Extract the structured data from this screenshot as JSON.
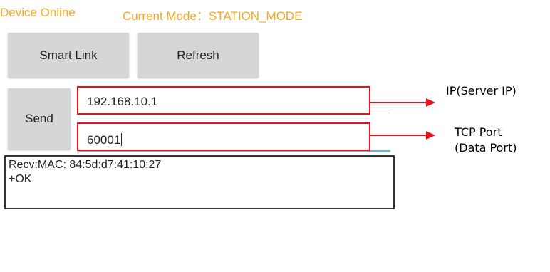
{
  "status": {
    "device_state": "Device Online",
    "current_mode": "Current Mode：STATION_MODE"
  },
  "buttons": {
    "smart_link": "Smart Link",
    "refresh": "Refresh",
    "send": "Send"
  },
  "fields": {
    "ip_value": "192.168.10.1",
    "port_value": "60001"
  },
  "recv": {
    "text": "Recv:MAC: 84:5d:d7:41:10:27\n+OK"
  },
  "annotations": {
    "ip_label": "IP(Server IP)",
    "port_label_line1": "TCP Port",
    "port_label_line2": "(Data Port)"
  },
  "colors": {
    "status_text": "#f5a623",
    "annotation_red": "#e8101a",
    "field_focus": "#4fc3e6"
  }
}
